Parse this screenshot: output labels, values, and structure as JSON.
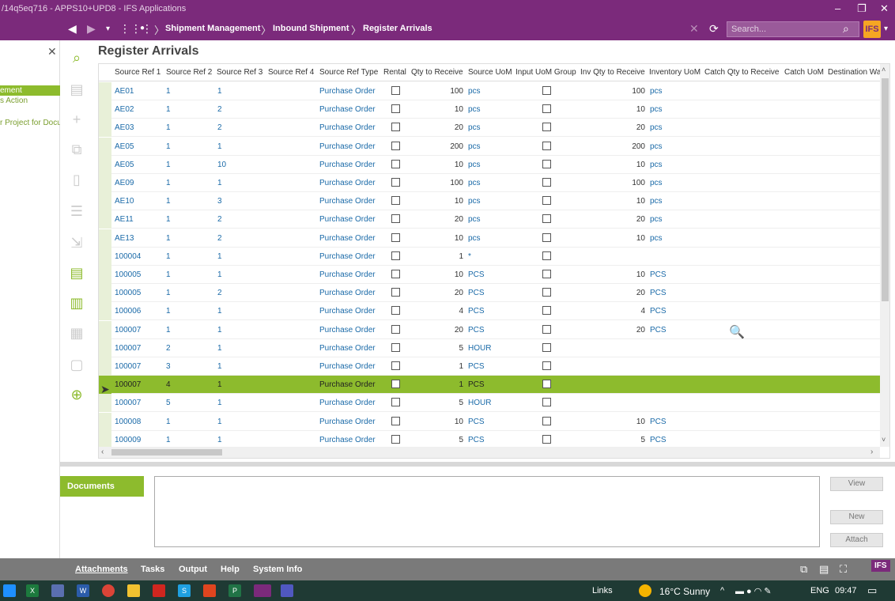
{
  "window": {
    "title": "/14q5eq716 - APPS10+UPD8 - IFS Applications",
    "controls": [
      "–",
      "❐",
      "✕"
    ]
  },
  "nav": {
    "breadcrumbs": [
      "Shipment Management",
      "Inbound Shipment",
      "Register Arrivals"
    ],
    "search_placeholder": "Search...",
    "logo": "IFS"
  },
  "left_panel": {
    "items": [
      "ement",
      "s Action",
      "r Project for Docu"
    ],
    "selected_index": 0
  },
  "page": {
    "title": "Register Arrivals"
  },
  "grid": {
    "columns": [
      "Source Ref 1",
      "Source Ref 2",
      "Source Ref 3",
      "Source Ref 4",
      "Source Ref Type",
      "Rental",
      "Qty to Receive",
      "Source UoM",
      "Input UoM Group",
      "Inv Qty to Receive",
      "Inventory UoM",
      "Catch Qty to Receive",
      "Catch UoM",
      "Destination Wa"
    ],
    "rows": [
      {
        "ref1": "AE01",
        "ref2": "1",
        "ref3": "1",
        "type": "Purchase Order",
        "qty": "100",
        "uom": "pcs",
        "inv_qty": "100",
        "inv_uom": "pcs"
      },
      {
        "ref1": "AE02",
        "ref2": "1",
        "ref3": "2",
        "type": "Purchase Order",
        "qty": "10",
        "uom": "pcs",
        "inv_qty": "10",
        "inv_uom": "pcs"
      },
      {
        "ref1": "AE03",
        "ref2": "1",
        "ref3": "2",
        "type": "Purchase Order",
        "qty": "20",
        "uom": "pcs",
        "inv_qty": "20",
        "inv_uom": "pcs"
      },
      {
        "ref1": "AE05",
        "ref2": "1",
        "ref3": "1",
        "type": "Purchase Order",
        "qty": "200",
        "uom": "pcs",
        "inv_qty": "200",
        "inv_uom": "pcs"
      },
      {
        "ref1": "AE05",
        "ref2": "1",
        "ref3": "10",
        "type": "Purchase Order",
        "qty": "10",
        "uom": "pcs",
        "inv_qty": "10",
        "inv_uom": "pcs"
      },
      {
        "ref1": "AE09",
        "ref2": "1",
        "ref3": "1",
        "type": "Purchase Order",
        "qty": "100",
        "uom": "pcs",
        "inv_qty": "100",
        "inv_uom": "pcs"
      },
      {
        "ref1": "AE10",
        "ref2": "1",
        "ref3": "3",
        "type": "Purchase Order",
        "qty": "10",
        "uom": "pcs",
        "inv_qty": "10",
        "inv_uom": "pcs"
      },
      {
        "ref1": "AE11",
        "ref2": "1",
        "ref3": "2",
        "type": "Purchase Order",
        "qty": "20",
        "uom": "pcs",
        "inv_qty": "20",
        "inv_uom": "pcs"
      },
      {
        "ref1": "AE13",
        "ref2": "1",
        "ref3": "2",
        "type": "Purchase Order",
        "qty": "10",
        "uom": "pcs",
        "inv_qty": "10",
        "inv_uom": "pcs"
      },
      {
        "ref1": "100004",
        "ref2": "1",
        "ref3": "1",
        "type": "Purchase Order",
        "qty": "1",
        "uom": "*",
        "inv_qty": "",
        "inv_uom": ""
      },
      {
        "ref1": "100005",
        "ref2": "1",
        "ref3": "1",
        "type": "Purchase Order",
        "qty": "10",
        "uom": "PCS",
        "inv_qty": "10",
        "inv_uom": "PCS"
      },
      {
        "ref1": "100005",
        "ref2": "1",
        "ref3": "2",
        "type": "Purchase Order",
        "qty": "20",
        "uom": "PCS",
        "inv_qty": "20",
        "inv_uom": "PCS"
      },
      {
        "ref1": "100006",
        "ref2": "1",
        "ref3": "1",
        "type": "Purchase Order",
        "qty": "4",
        "uom": "PCS",
        "inv_qty": "4",
        "inv_uom": "PCS"
      },
      {
        "ref1": "100007",
        "ref2": "1",
        "ref3": "1",
        "type": "Purchase Order",
        "qty": "20",
        "uom": "PCS",
        "inv_qty": "20",
        "inv_uom": "PCS"
      },
      {
        "ref1": "100007",
        "ref2": "2",
        "ref3": "1",
        "type": "Purchase Order",
        "qty": "5",
        "uom": "HOUR",
        "inv_qty": "",
        "inv_uom": ""
      },
      {
        "ref1": "100007",
        "ref2": "3",
        "ref3": "1",
        "type": "Purchase Order",
        "qty": "1",
        "uom": "PCS",
        "inv_qty": "",
        "inv_uom": ""
      },
      {
        "ref1": "100007",
        "ref2": "4",
        "ref3": "1",
        "type": "Purchase Order",
        "qty": "1",
        "uom": "PCS",
        "inv_qty": "",
        "inv_uom": "",
        "selected": true
      },
      {
        "ref1": "100007",
        "ref2": "5",
        "ref3": "1",
        "type": "Purchase Order",
        "qty": "5",
        "uom": "HOUR",
        "inv_qty": "",
        "inv_uom": ""
      },
      {
        "ref1": "100008",
        "ref2": "1",
        "ref3": "1",
        "type": "Purchase Order",
        "qty": "10",
        "uom": "PCS",
        "inv_qty": "10",
        "inv_uom": "PCS"
      },
      {
        "ref1": "100009",
        "ref2": "1",
        "ref3": "1",
        "type": "Purchase Order",
        "qty": "5",
        "uom": "PCS",
        "inv_qty": "5",
        "inv_uom": "PCS"
      }
    ]
  },
  "documents": {
    "tab_label": "Documents",
    "buttons": [
      "View",
      "New",
      "Attach"
    ]
  },
  "bottom_bar": {
    "links": [
      "Attachments",
      "Tasks",
      "Output",
      "Help",
      "System Info"
    ]
  },
  "taskbar": {
    "links_label": "Links",
    "weather": "16°C  Sunny",
    "lang": "ENG",
    "time": "09:47"
  },
  "colors": {
    "brand": "#7b2a7b",
    "accent": "#8dbb2d",
    "link": "#1a6aa8"
  }
}
